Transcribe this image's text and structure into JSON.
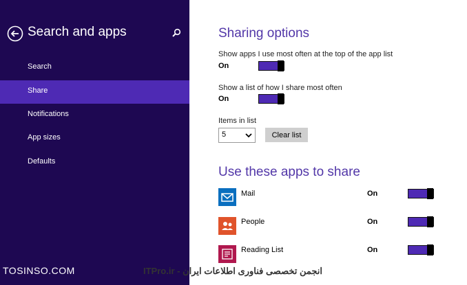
{
  "sidebar": {
    "title": "Search and apps",
    "items": [
      {
        "label": "Search"
      },
      {
        "label": "Share"
      },
      {
        "label": "Notifications"
      },
      {
        "label": "App sizes"
      },
      {
        "label": "Defaults"
      }
    ],
    "selected": "Share"
  },
  "sharing": {
    "title": "Sharing options",
    "option1_label": "Show apps I use most often at the top of the app list",
    "option1_state": "On",
    "option2_label": "Show a list of how I share most often",
    "option2_state": "On",
    "items_label": "Items in list",
    "items_value": "5",
    "clear_button": "Clear list"
  },
  "apps": {
    "title": "Use these apps to share",
    "list": [
      {
        "name": "Mail",
        "state": "On",
        "icon": "mail-icon",
        "color": "#0a6fbf"
      },
      {
        "name": "People",
        "state": "On",
        "icon": "people-icon",
        "color": "#e0532b"
      },
      {
        "name": "Reading List",
        "state": "On",
        "icon": "reading-list-icon",
        "color": "#b0184e"
      }
    ]
  },
  "watermark": {
    "left": "TOSINSO.COM",
    "right": "ITPro.ir - انجمن تخصصی فناوری اطلاعات ایران"
  },
  "colors": {
    "sidebar_bg": "#1e0852",
    "accent": "#4e2ab4",
    "title": "#5237a8"
  }
}
